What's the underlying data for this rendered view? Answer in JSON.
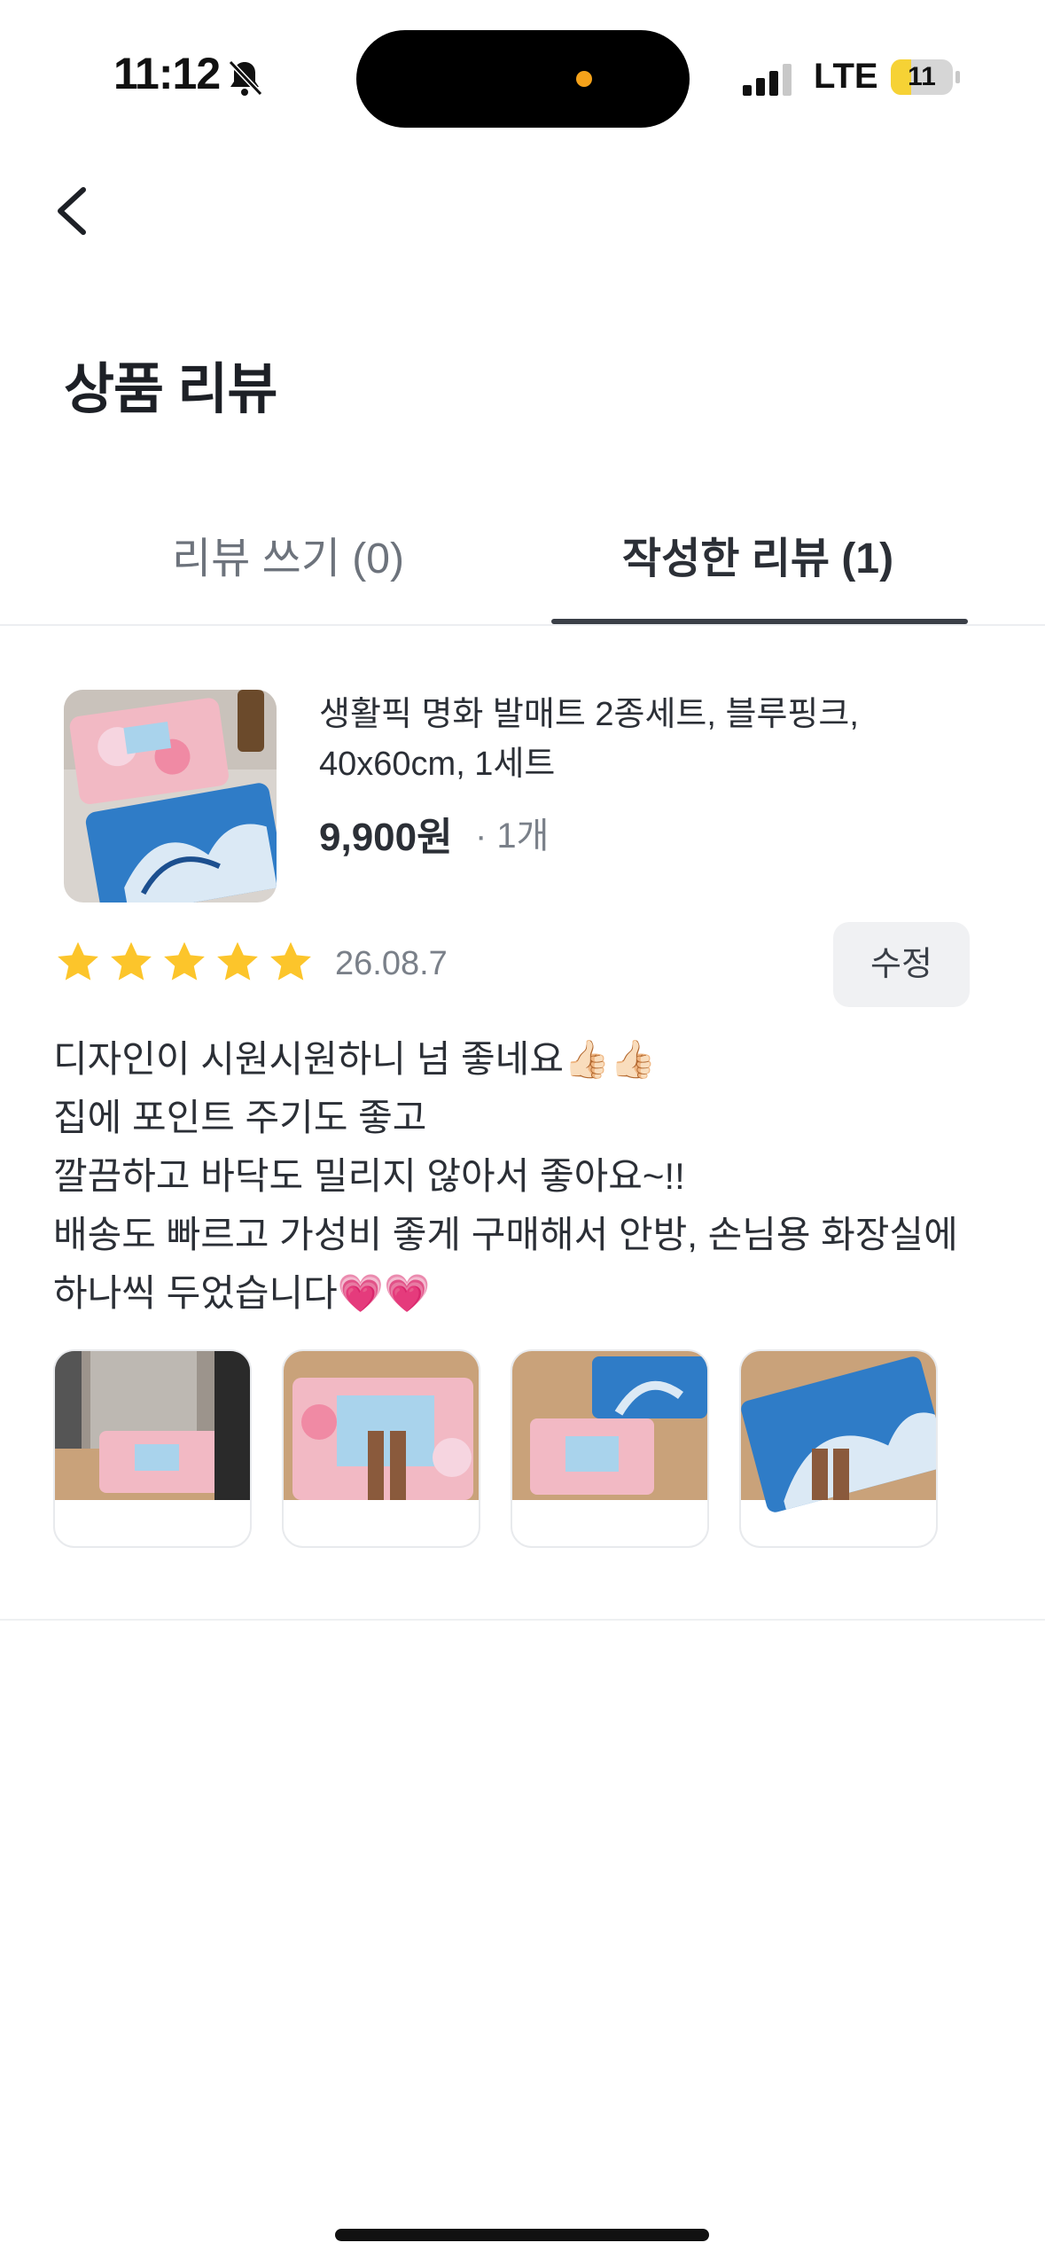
{
  "status_bar": {
    "time": "11:12",
    "network": "LTE",
    "battery": "11",
    "icons": [
      "bell-slash-icon",
      "signal-icon",
      "battery-icon"
    ]
  },
  "header": {
    "back_icon": "chevron-left-icon",
    "title": "상품 리뷰"
  },
  "tabs": [
    {
      "label": "리뷰 쓰기 (0)",
      "active": false
    },
    {
      "label": "작성한 리뷰 (1)",
      "active": true
    }
  ],
  "review": {
    "product": {
      "name": "생활픽 명화 발매트 2종세트, 블루핑크, 40x60cm, 1세트",
      "price": "9,900원",
      "quantity": "· 1개"
    },
    "rating": 5,
    "date": "26.08.7",
    "edit_label": "수정",
    "text_lines": [
      "디자인이 시원시원하니 넘 좋네요👍🏻👍🏻",
      "집에 포인트 주기도 좋고",
      "깔끔하고 바닥도 밀리지 않아서 좋아요~!!",
      "배송도 빠르고 가성비 좋게 구매해서 안방, 손님용 화장실에",
      "하나씩 두었습니다💗💗"
    ],
    "photo_count": 4
  },
  "colors": {
    "star": "#fcc52b",
    "tab_active": "#3a3f47",
    "text_primary": "#2b2f36",
    "text_secondary": "#7a8089",
    "battery_fill": "#f6d235"
  }
}
